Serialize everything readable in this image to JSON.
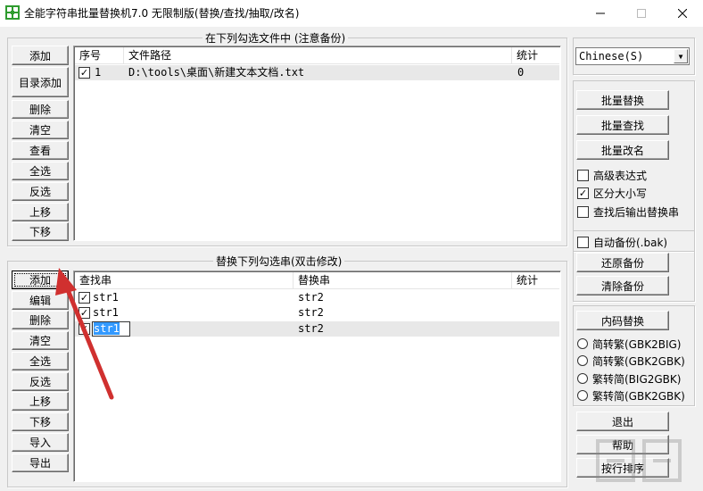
{
  "window": {
    "title": "全能字符串批量替换机7.0 无限制版(替换/查找/抽取/改名)"
  },
  "files_group": {
    "title": "在下列勾选文件中 (注意备份)",
    "buttons": [
      "添加",
      "目录添加",
      "删除",
      "清空",
      "查看",
      "全选",
      "反选",
      "上移",
      "下移"
    ],
    "columns": [
      "序号",
      "文件路径",
      "统计"
    ],
    "rows": [
      {
        "checked": true,
        "index": "1",
        "path": "D:\\tools\\桌面\\新建文本文档.txt",
        "count": "0"
      }
    ]
  },
  "replace_group": {
    "title": "替换下列勾选串(双击修改)",
    "buttons": [
      "添加",
      "编辑",
      "删除",
      "清空",
      "全选",
      "反选",
      "上移",
      "下移",
      "导入",
      "导出"
    ],
    "columns": [
      "查找串",
      "替换串",
      "统计"
    ],
    "rows": [
      {
        "checked": true,
        "find": "str1",
        "replace": "str2",
        "count": ""
      },
      {
        "checked": true,
        "find": "str1",
        "replace": "str2",
        "count": ""
      },
      {
        "checked": true,
        "find": "str1",
        "replace": "str2",
        "count": "",
        "editing": true
      }
    ]
  },
  "right_panel": {
    "language": "Chinese(S)",
    "batch_replace": "批量替换",
    "batch_find": "批量查找",
    "batch_rename": "批量改名",
    "options": [
      {
        "label": "高级表达式",
        "checked": false
      },
      {
        "label": "区分大小写",
        "checked": true
      },
      {
        "label": "查找后输出替换串",
        "checked": false
      }
    ],
    "auto_backup": {
      "label": "自动备份(.bak)",
      "checked": false
    },
    "restore_backup": "还原备份",
    "clear_backup": "清除备份",
    "charset_replace": "内码替换",
    "radios": [
      "简转繁(GBK2BIG)",
      "简转繁(GBK2GBK)",
      "繁转简(BIG2GBK)",
      "繁转简(GBK2GBK)"
    ],
    "exit": "退出",
    "help": "帮助",
    "sort_lines": "按行排序"
  },
  "colors": {
    "arrow": "#d0302f",
    "selection": "#3399ff",
    "window_bg": "#f0f0f0"
  }
}
